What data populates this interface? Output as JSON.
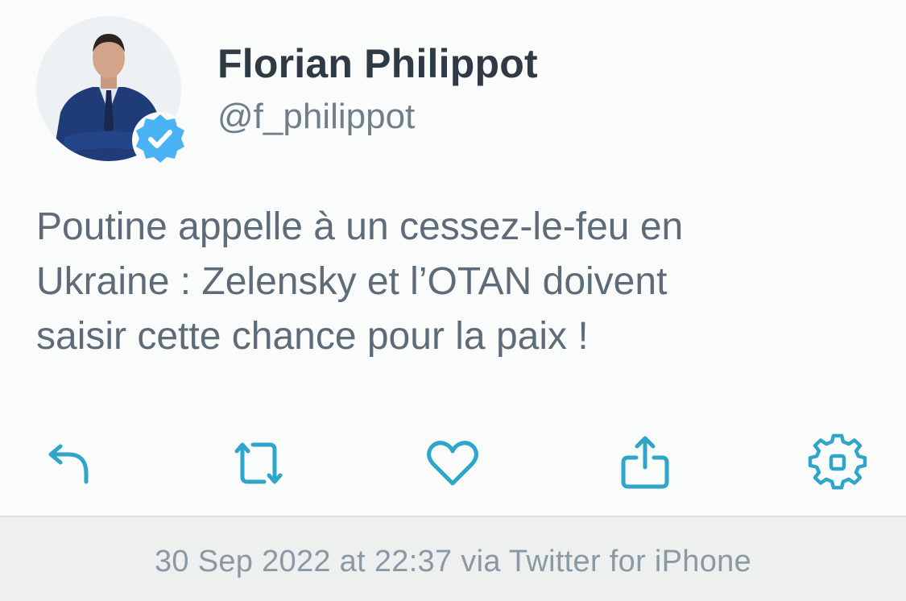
{
  "author": {
    "name": "Florian Philippot",
    "handle": "@f_philippot",
    "verified": true
  },
  "tweet": {
    "text": "Poutine appelle à un cessez-le-feu en\nUkraine : Zelensky et l’OTAN doivent\nsaisir cette chance pour la paix !"
  },
  "actions": [
    {
      "icon": "reply-icon"
    },
    {
      "icon": "retweet-icon"
    },
    {
      "icon": "heart-icon"
    },
    {
      "icon": "share-icon"
    },
    {
      "icon": "gear-icon"
    }
  ],
  "meta": {
    "timestamp": "30 Sep 2022 at 22:37 via Twitter for iPhone"
  },
  "colors": {
    "accent": "#2fa6c9",
    "verified": "#4ab3f4",
    "name": "#2e3a44",
    "text": "#5d6c78"
  }
}
